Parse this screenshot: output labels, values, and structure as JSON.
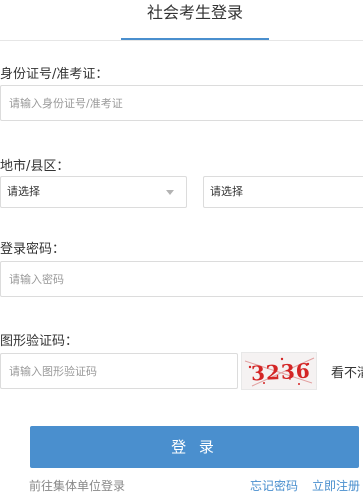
{
  "header": {
    "title": "社会考生登录"
  },
  "id_number": {
    "label": "身份证号/准考证：",
    "placeholder": "请输入身份证号/准考证"
  },
  "region": {
    "label": "地市/县区：",
    "city_selected": "请选择",
    "county_selected": "请选择"
  },
  "password": {
    "label": "登录密码：",
    "placeholder": "请输入密码"
  },
  "captcha": {
    "label": "图形验证码：",
    "placeholder": "请输入图形验证码",
    "image_text": "3236",
    "refresh_label": "看不清"
  },
  "login_button": "登 录",
  "footer": {
    "unit_login": "前往集体单位登录",
    "forgot_password": "忘记密码",
    "register": "立即注册"
  },
  "colors": {
    "accent": "#4a8fce",
    "captcha_red": "#d42525",
    "muted_text": "#999999"
  }
}
